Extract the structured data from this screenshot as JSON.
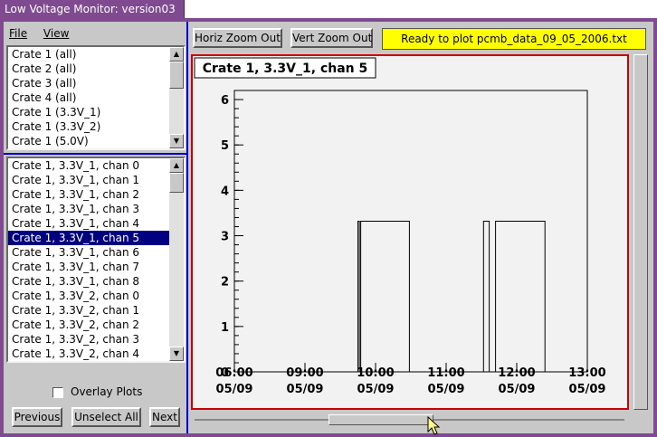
{
  "window": {
    "title": "Low Voltage Monitor: version03"
  },
  "menu": {
    "file": "File",
    "view": "View"
  },
  "crate_list": {
    "items": [
      "Crate 1 (all)",
      "Crate 2 (all)",
      "Crate 3 (all)",
      "Crate 4 (all)",
      "Crate 1 (3.3V_1)",
      "Crate 1 (3.3V_2)",
      "Crate 1 (5.0V)"
    ]
  },
  "channel_list": {
    "items": [
      "Crate 1, 3.3V_1, chan 0",
      "Crate 1, 3.3V_1, chan 1",
      "Crate 1, 3.3V_1, chan 2",
      "Crate 1, 3.3V_1, chan 3",
      "Crate 1, 3.3V_1, chan 4",
      "Crate 1, 3.3V_1, chan 5",
      "Crate 1, 3.3V_1, chan 6",
      "Crate 1, 3.3V_1, chan 7",
      "Crate 1, 3.3V_1, chan 8",
      "Crate 1, 3.3V_2, chan 0",
      "Crate 1, 3.3V_2, chan 1",
      "Crate 1, 3.3V_2, chan 2",
      "Crate 1, 3.3V_2, chan 3",
      "Crate 1, 3.3V_2, chan 4"
    ],
    "selected_index": 5
  },
  "controls": {
    "overlay_label": "Overlay Plots",
    "overlay_checked": false,
    "previous": "Previous",
    "unselect_all": "Unselect All",
    "next": "Next",
    "horiz_zoom_out": "Horiz Zoom Out",
    "vert_zoom_out": "Vert Zoom Out"
  },
  "status": {
    "text": "Ready to plot pcmb_data_09_05_2006.txt",
    "color": "#ffff00"
  },
  "chart_data": {
    "type": "line",
    "title": "Crate 1, 3.3V_1, chan 5",
    "xlabel": "",
    "ylabel": "",
    "x_ticks": [
      {
        "time": "06:00",
        "date": "05/09",
        "hour": 6
      },
      {
        "time": "09:00",
        "date": "05/09",
        "hour": 9
      },
      {
        "time": "10:00",
        "date": "05/09",
        "hour": 10
      },
      {
        "time": "11:00",
        "date": "05/09",
        "hour": 11
      },
      {
        "time": "12:00",
        "date": "05/09",
        "hour": 12
      },
      {
        "time": "13:00",
        "date": "05/09",
        "hour": 13
      }
    ],
    "y_ticks": [
      0,
      1,
      2,
      3,
      4,
      5,
      6
    ],
    "ylim": [
      0,
      6.2
    ],
    "series": [
      {
        "step_points": [
          [
            6.0,
            0
          ],
          [
            9.75,
            0
          ],
          [
            9.75,
            3.32
          ],
          [
            9.77,
            3.32
          ],
          [
            9.77,
            0
          ],
          [
            9.79,
            0
          ],
          [
            9.79,
            3.32
          ],
          [
            10.48,
            3.32
          ],
          [
            10.48,
            0
          ],
          [
            11.53,
            0
          ],
          [
            11.53,
            3.32
          ],
          [
            11.61,
            3.32
          ],
          [
            11.61,
            0
          ],
          [
            11.7,
            0
          ],
          [
            11.7,
            3.32
          ],
          [
            12.4,
            3.32
          ],
          [
            12.4,
            0
          ],
          [
            13.0,
            0
          ]
        ]
      }
    ],
    "grid": false
  }
}
